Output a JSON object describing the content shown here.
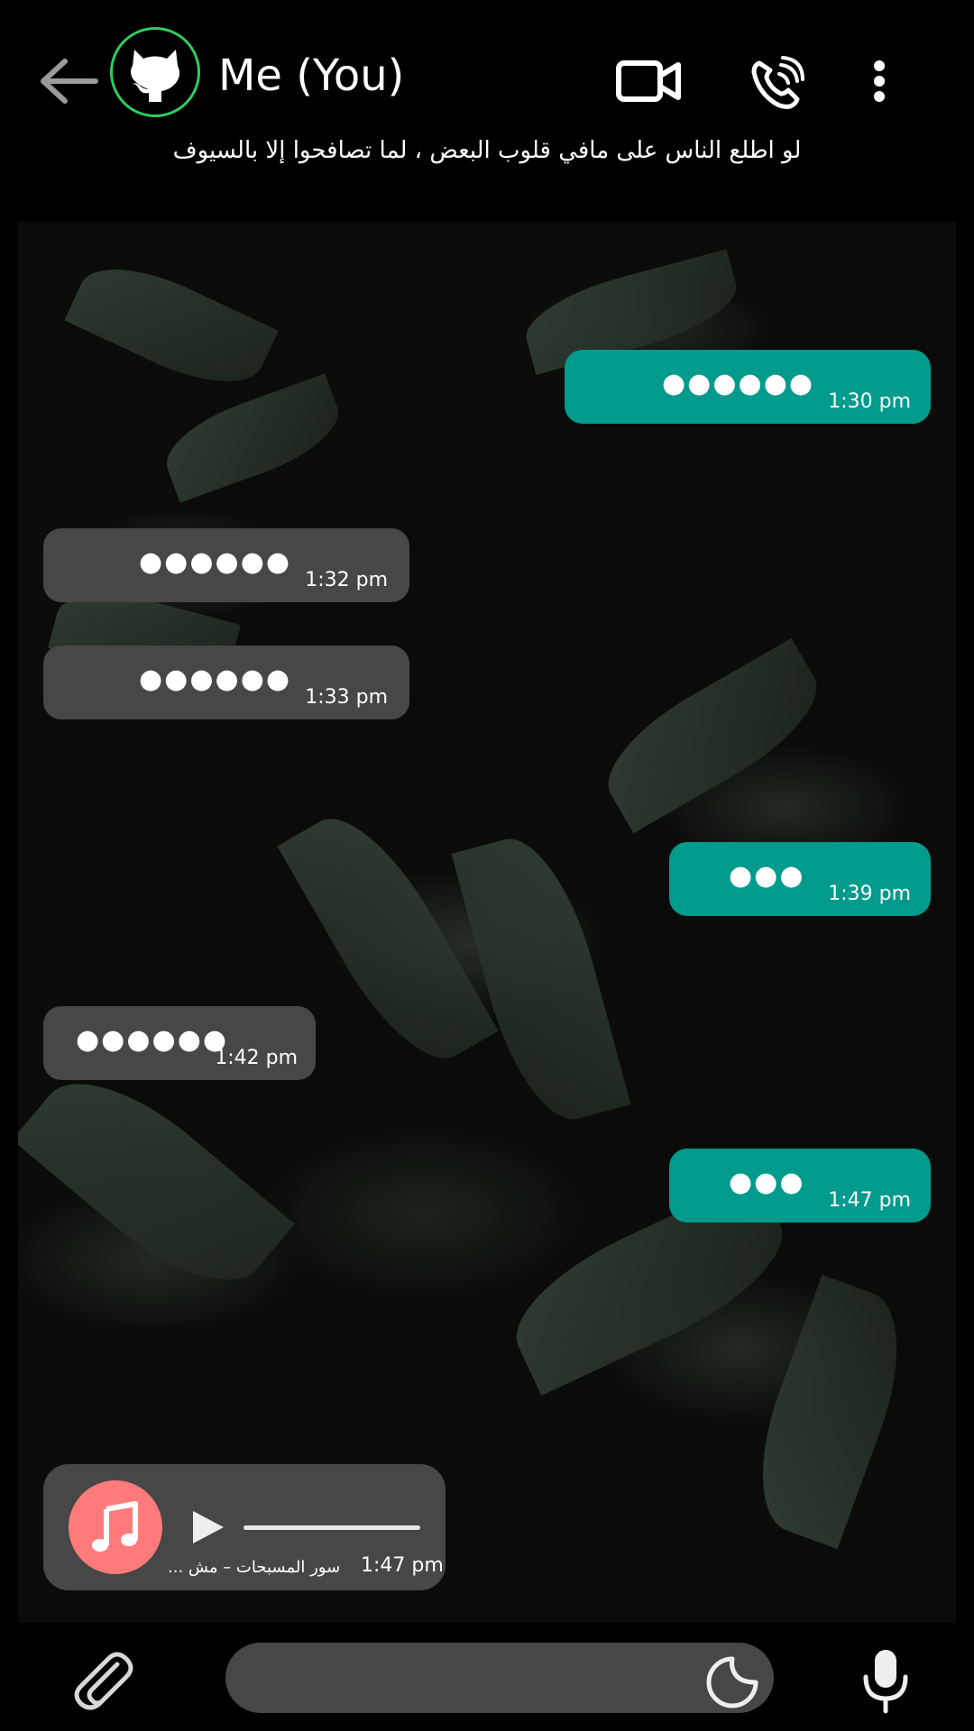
{
  "header": {
    "title": "Me (You)",
    "status": "لو اطلع الناس على مافي قلوب البعض ، لما تصافحوا إلا بالسيوف",
    "icons": [
      "back-arrow-icon",
      "github-avatar-icon",
      "video-call-icon",
      "phone-call-icon",
      "more-options-icon"
    ]
  },
  "colors": {
    "outgoing_bubble": "#009b8d",
    "incoming_bubble": "#474747",
    "avatar_ring": "#2ecc5e",
    "audio_disc": "#ff7b7b",
    "background": "#000000"
  },
  "messages": [
    {
      "direction": "out",
      "text": "●●●●●●",
      "time": "1:30 pm"
    },
    {
      "direction": "in",
      "text": "●●●●●●",
      "time": "1:32 pm"
    },
    {
      "direction": "in",
      "text": "●●●●●●",
      "time": "1:33 pm"
    },
    {
      "direction": "out",
      "text": "●●●",
      "time": "1:39 pm"
    },
    {
      "direction": "in",
      "text": "●●●●●●",
      "time": "1:42 pm"
    },
    {
      "direction": "out",
      "text": "●●●",
      "time": "1:47 pm"
    }
  ],
  "audio_message": {
    "caption": "... سور المسبحات – مش",
    "time": "1:47 pm",
    "icons": [
      "music-note-icon",
      "play-icon"
    ]
  },
  "composer": {
    "placeholder": "",
    "icons": [
      "attach-paperclip-icon",
      "sticker-icon",
      "microphone-icon"
    ]
  }
}
